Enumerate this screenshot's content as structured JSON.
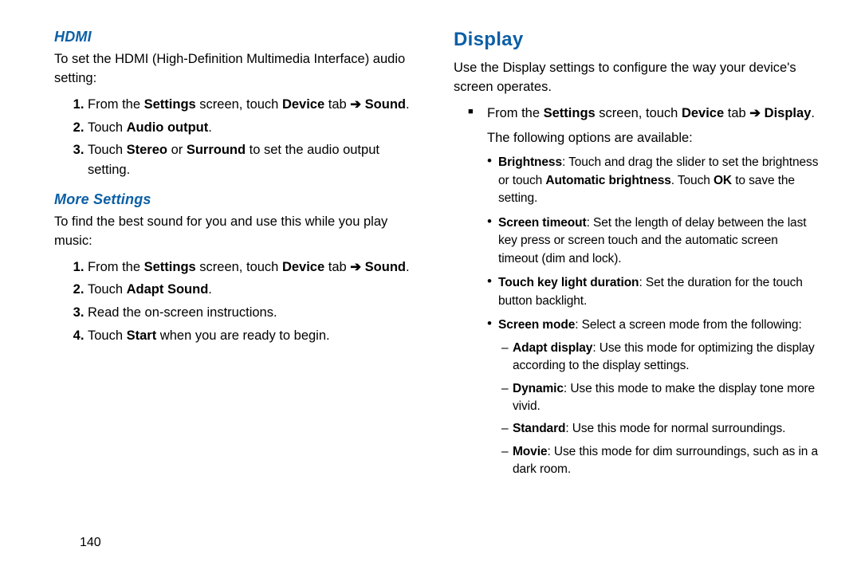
{
  "page_number": "140",
  "left": {
    "hdmi_heading": "HDMI",
    "hdmi_intro": "To set the HDMI (High-Definition Multimedia Interface) audio setting:",
    "hdmi_steps": [
      {
        "pre": "From the ",
        "b1": "Settings",
        "mid": " screen, touch ",
        "b2": "Device",
        "mid2": " tab ",
        "arrow": "➔",
        "b3": " Sound",
        "post": "."
      },
      {
        "pre": "Touch ",
        "b1": "Audio output",
        "post": "."
      },
      {
        "pre": "Touch ",
        "b1": "Stereo",
        "mid": " or ",
        "b2": "Surround",
        "post": " to set the audio output setting."
      }
    ],
    "more_heading": "More Settings",
    "more_intro": "To find the best sound for you and use this while you play music:",
    "more_steps": [
      {
        "pre": "From the ",
        "b1": "Settings",
        "mid": " screen, touch ",
        "b2": "Device",
        "mid2": " tab ",
        "arrow": "➔",
        "b3": " Sound",
        "post": "."
      },
      {
        "pre": "Touch ",
        "b1": "Adapt Sound",
        "post": "."
      },
      {
        "plain": "Read the on-screen instructions."
      },
      {
        "pre": "Touch ",
        "b1": "Start",
        "post": " when you are ready to begin."
      }
    ]
  },
  "right": {
    "display_heading": "Display",
    "display_intro": "Use the Display settings to configure the way your device's screen operates.",
    "square_step": {
      "pre": "From the ",
      "b1": "Settings",
      "mid": " screen, touch ",
      "b2": "Device",
      "mid2": " tab ",
      "arrow": "➔",
      "b3": " Display",
      "post": "."
    },
    "following": "The following options are available:",
    "options": [
      {
        "b": "Brightness",
        "text": ": Touch and drag the slider to set the brightness or touch ",
        "b2": "Automatic brightness",
        "text2": ". Touch ",
        "b3": "OK",
        "text3": " to save the setting."
      },
      {
        "b": "Screen timeout",
        "text": ": Set the length of delay between the last key press or screen touch and the automatic screen timeout (dim and lock)."
      },
      {
        "b": "Touch key light duration",
        "text": ": Set the duration for the touch button backlight."
      },
      {
        "b": "Screen mode",
        "text": ": Select a screen mode from the following:",
        "sub": [
          {
            "b": "Adapt display",
            "text": ": Use this mode for optimizing the display according to the display settings."
          },
          {
            "b": "Dynamic",
            "text": ": Use this mode to make the display tone more vivid."
          },
          {
            "b": "Standard",
            "text": ": Use this mode for normal surroundings."
          },
          {
            "b": "Movie",
            "text": ": Use this mode for dim surroundings, such as in a dark room."
          }
        ]
      }
    ]
  }
}
